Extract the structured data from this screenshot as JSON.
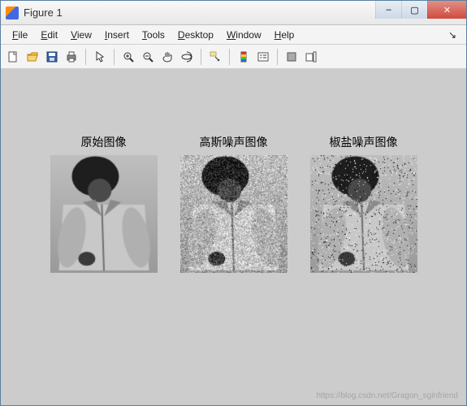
{
  "window": {
    "title": "Figure 1",
    "controls": {
      "min": "–",
      "max": "▢",
      "close": "✕"
    }
  },
  "menubar": {
    "items": [
      {
        "mnemonic": "F",
        "rest": "ile"
      },
      {
        "mnemonic": "E",
        "rest": "dit"
      },
      {
        "mnemonic": "V",
        "rest": "iew"
      },
      {
        "mnemonic": "I",
        "rest": "nsert"
      },
      {
        "mnemonic": "T",
        "rest": "ools"
      },
      {
        "mnemonic": "D",
        "rest": "esktop"
      },
      {
        "mnemonic": "W",
        "rest": "indow"
      },
      {
        "mnemonic": "H",
        "rest": "elp"
      }
    ],
    "arrow": "↘"
  },
  "toolbar": {
    "icons": [
      "new-figure-icon",
      "open-icon",
      "save-icon",
      "print-icon",
      "sep",
      "pointer-icon",
      "sep",
      "zoom-in-icon",
      "zoom-out-icon",
      "pan-icon",
      "rotate-3d-icon",
      "sep",
      "data-cursor-icon",
      "sep",
      "colorbar-icon",
      "legend-icon",
      "sep",
      "hide-plot-tools-icon",
      "show-plot-tools-icon"
    ]
  },
  "subplots": [
    {
      "title": "原始图像",
      "noise": "none"
    },
    {
      "title": "高斯噪声图像",
      "noise": "gaussian"
    },
    {
      "title": "椒盐噪声图像",
      "noise": "saltpepper"
    }
  ],
  "watermark": "https://blog.csdn.net/Gragon_sginfriend"
}
